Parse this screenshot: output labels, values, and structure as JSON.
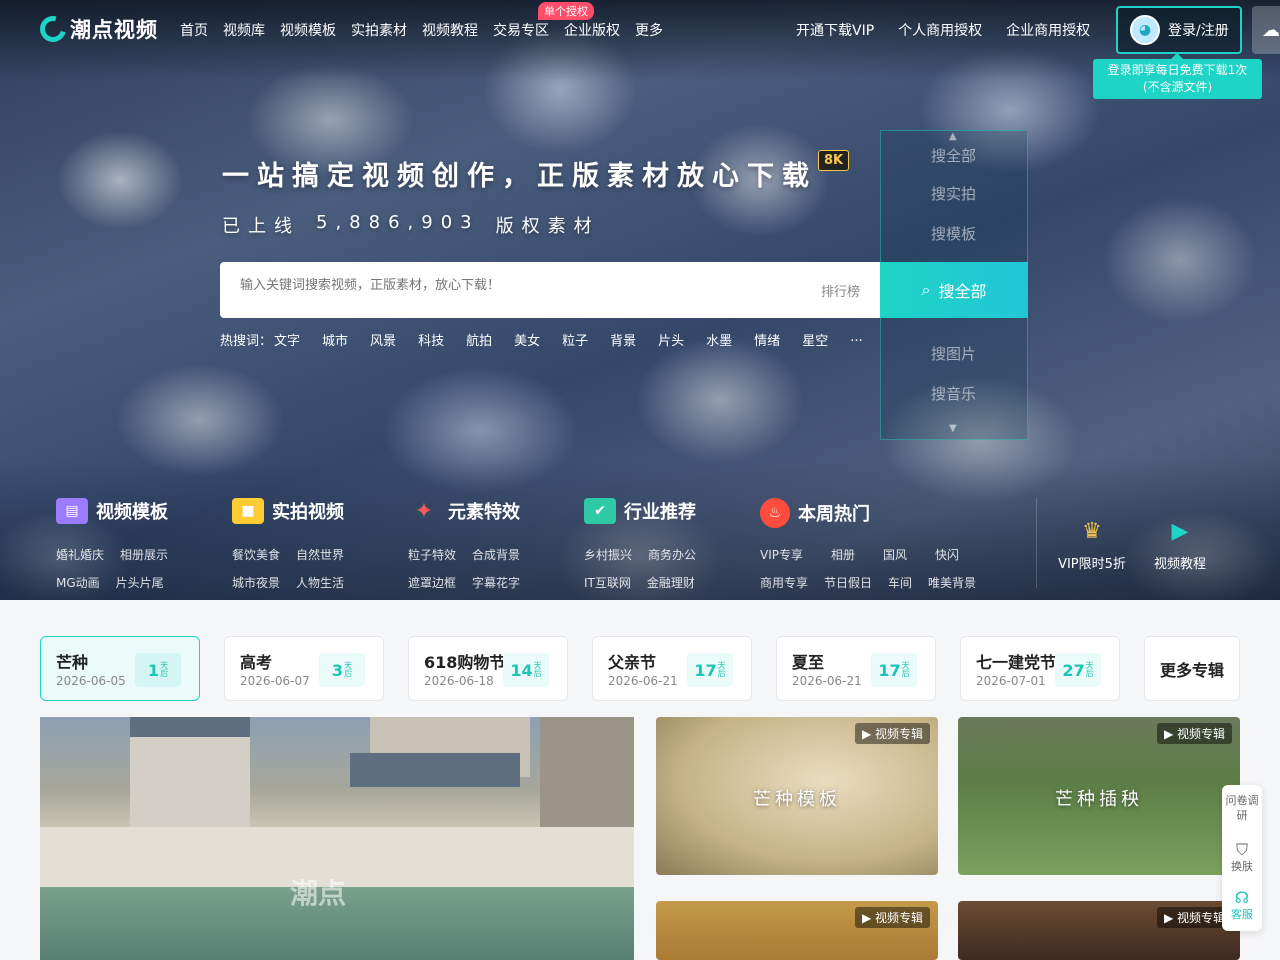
{
  "brand": {
    "name": "潮点视频"
  },
  "nav": {
    "items": [
      "首页",
      "视频库",
      "视频模板",
      "实拍素材",
      "视频教程",
      "交易专区",
      "企业版权",
      "更多"
    ],
    "badge": "单个授权",
    "right_items": [
      "开通下载VIP",
      "个人商用授权",
      "企业商用授权"
    ]
  },
  "account": {
    "login_label": "登录/注册",
    "tip_line1": "登录即享每日免费下载1次",
    "tip_line2": "(不含源文件)"
  },
  "hero": {
    "slogan": "一站搞定视频创作，正版素材放心下载",
    "badge": "8K",
    "count_prefix": "已上线",
    "count": "5,886,903",
    "count_suffix": "版权素材"
  },
  "search": {
    "placeholder": "输入关键词搜索视频，正版素材，放心下载！",
    "rank_label": "排行榜",
    "button_label": "搜全部",
    "scope_options": [
      "搜全部",
      "搜实拍",
      "搜模板",
      "搜图片",
      "搜音乐"
    ],
    "hot_label": "热搜词：",
    "hot_words": [
      "文字",
      "城市",
      "风景",
      "科技",
      "航拍",
      "美女",
      "粒子",
      "背景",
      "片头",
      "水墨",
      "情绪",
      "星空",
      "..."
    ]
  },
  "categories": [
    {
      "title": "视频模板",
      "color": "#9b7cff",
      "rows": [
        [
          "婚礼婚庆",
          "相册展示"
        ],
        [
          "MG动画",
          "片头片尾"
        ]
      ]
    },
    {
      "title": "实拍视频",
      "color": "#ffcc33",
      "rows": [
        [
          "餐饮美食",
          "自然世界"
        ],
        [
          "城市夜景",
          "人物生活"
        ]
      ]
    },
    {
      "title": "元素特效",
      "color": "#ff5a5a",
      "rows": [
        [
          "粒子特效",
          "合成背景"
        ],
        [
          "遮罩边框",
          "字幕花字"
        ]
      ]
    },
    {
      "title": "行业推荐",
      "color": "#2ec9a5",
      "rows": [
        [
          "乡村振兴",
          "商务办公"
        ],
        [
          "IT互联网",
          "金融理财"
        ]
      ]
    },
    {
      "title": "本周热门",
      "color": "#ff4d3d",
      "rows": [
        [
          "VIP专享",
          "相册",
          "国风",
          "快闪"
        ],
        [
          "商用专享",
          "节日假日",
          "车间",
          "唯美背景"
        ]
      ]
    }
  ],
  "quick_links": [
    {
      "label": "VIP限时5折",
      "icon": "crown-icon"
    },
    {
      "label": "视频教程",
      "icon": "video-play-icon"
    }
  ],
  "topics": [
    {
      "name": "芒种",
      "date": "2026-06-05",
      "days": "1",
      "unit": "天后"
    },
    {
      "name": "高考",
      "date": "2026-06-07",
      "days": "3",
      "unit": "天后"
    },
    {
      "name": "618购物节",
      "date": "2026-06-18",
      "days": "14",
      "unit": "天后"
    },
    {
      "name": "父亲节",
      "date": "2026-06-21",
      "days": "17",
      "unit": "天后"
    },
    {
      "name": "夏至",
      "date": "2026-06-21",
      "days": "17",
      "unit": "天后"
    },
    {
      "name": "七一建党节",
      "date": "2026-07-01",
      "days": "27",
      "unit": "天后"
    }
  ],
  "more_topics": "更多专辑",
  "featured": {
    "watermark": "潮点",
    "tiles": [
      {
        "tag": "视频专辑",
        "caption": "芒种模板"
      },
      {
        "tag": "视频专辑",
        "caption": "芒种插秧"
      },
      {
        "tag": "视频专辑",
        "caption": ""
      },
      {
        "tag": "视频专辑",
        "caption": ""
      }
    ]
  },
  "side_tools": [
    {
      "label": "问卷调研"
    },
    {
      "label": "换肤",
      "icon": "shirt-icon"
    },
    {
      "label": "客服",
      "icon": "headset-icon"
    }
  ]
}
